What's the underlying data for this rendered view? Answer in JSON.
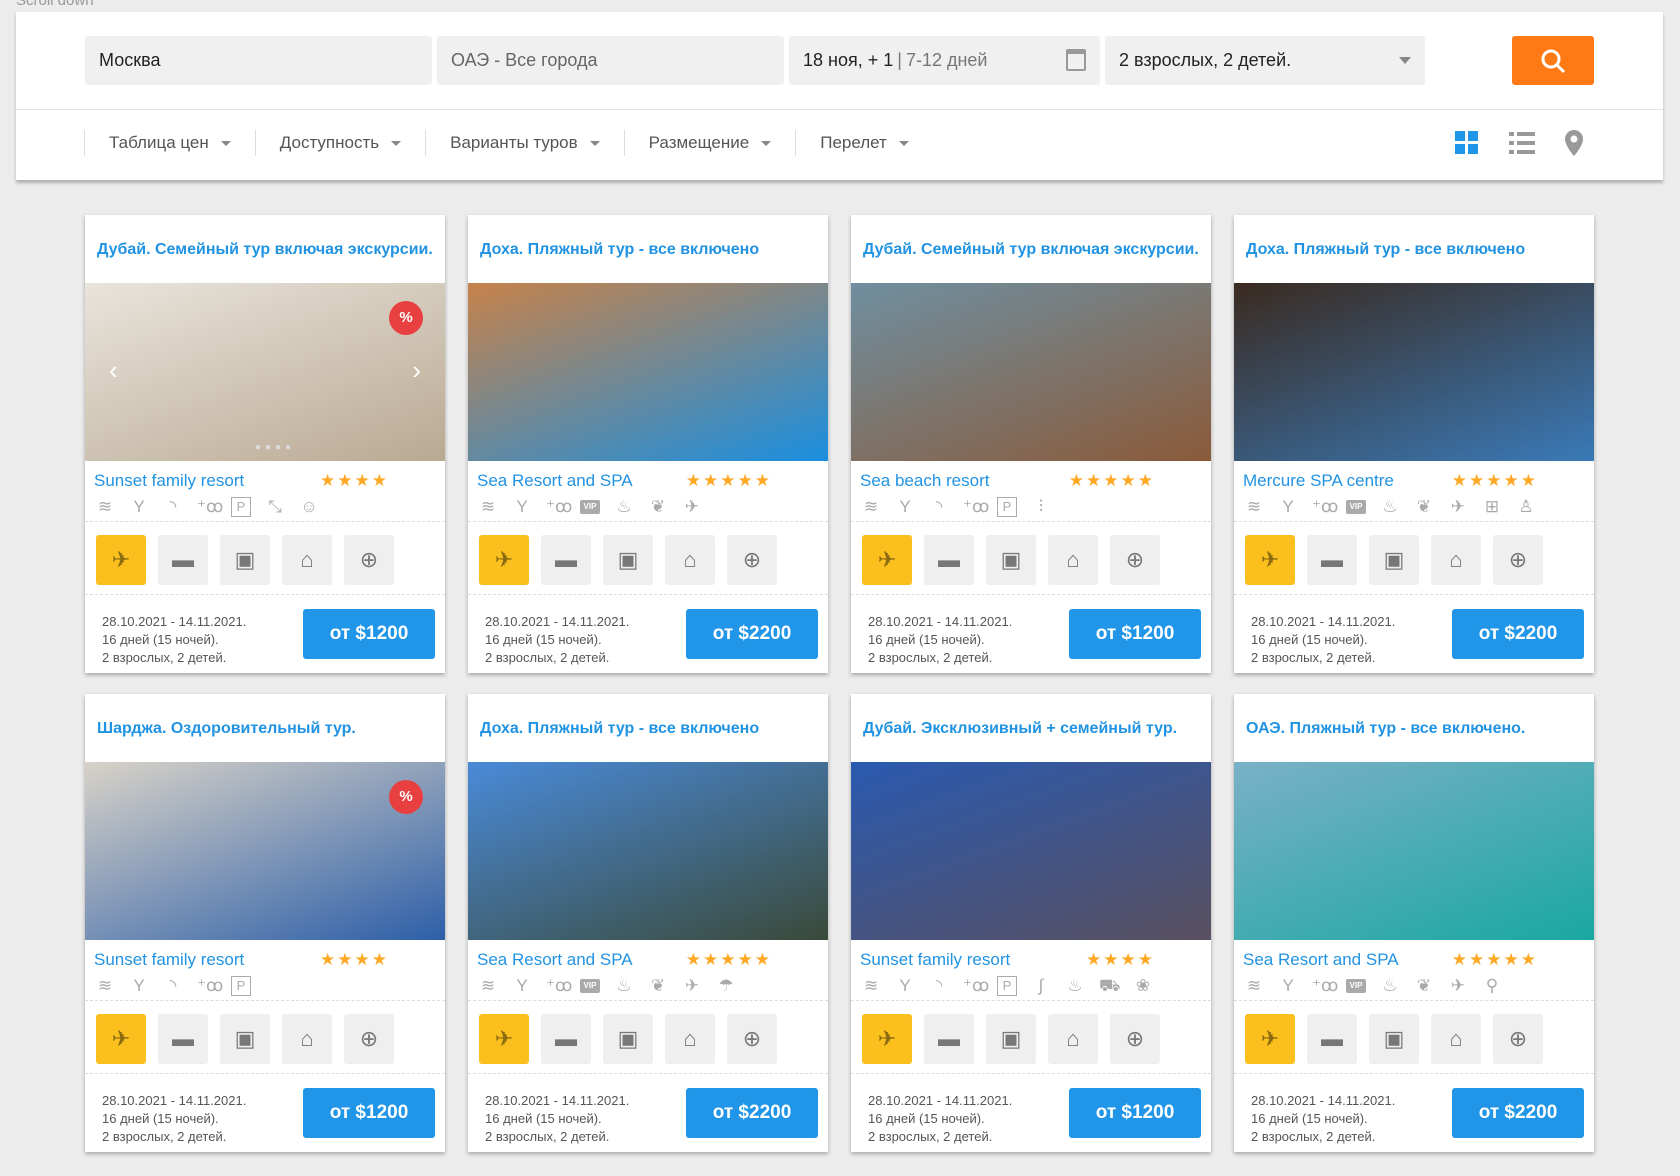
{
  "scroll_hint": "Scroll down",
  "search": {
    "from": "Москва",
    "to": "ОАЭ - Все города",
    "date_main": "18 ноя, + 1",
    "date_range": "7-12 дней",
    "guests": "2 взрослых, 2 детей."
  },
  "filters": [
    "Таблица цен",
    "Доступность",
    "Варианты туров",
    "Размещение",
    "Перелет"
  ],
  "colors": {
    "accent": "#2196e8",
    "search_button": "#ff7a14",
    "stars": "#ffa826",
    "active_service": "#fbbf1e"
  },
  "services": [
    "plane-icon",
    "bed-icon",
    "bus-icon",
    "museum-icon",
    "globe-icon"
  ],
  "cards": [
    {
      "title": "Дубай. Семейный тур включая экскурсии.",
      "hotel": "Sunset family resort",
      "stars": 4,
      "discount": true,
      "carousel": true,
      "amenities": [
        "pool",
        "bar",
        "wifi",
        "family",
        "parking",
        "gym",
        "baby"
      ],
      "dates": "28.10.2021 - 14.11.2021.",
      "duration": "16 дней (15 ночей).",
      "guests": "2 взрослых, 2 детей.",
      "price": "от $1200",
      "photo": [
        "#e9e4dc",
        "#b9a992"
      ]
    },
    {
      "title": "Доха. Пляжный тур - все включено",
      "hotel": "Sea Resort and SPA",
      "stars": 5,
      "discount": false,
      "carousel": false,
      "amenities": [
        "pool",
        "bar",
        "family",
        "vip",
        "spa",
        "eco",
        "airport"
      ],
      "dates": "28.10.2021 - 14.11.2021.",
      "duration": "16 дней (15 ночей).",
      "guests": "2 взрослых, 2 детей.",
      "price": "от $2200",
      "photo": [
        "#c7824a",
        "#1a8fe0"
      ]
    },
    {
      "title": "Дубай. Семейный тур включая экскурсии.",
      "hotel": "Sea beach resort",
      "stars": 5,
      "discount": false,
      "carousel": false,
      "amenities": [
        "pool",
        "bar",
        "wifi",
        "family",
        "parking",
        "pool-lift"
      ],
      "dates": "28.10.2021 - 14.11.2021.",
      "duration": "16 дней (15 ночей).",
      "guests": "2 взрослых, 2 детей.",
      "price": "от $1200",
      "photo": [
        "#6f8fa0",
        "#8a5a3a"
      ]
    },
    {
      "title": "Доха. Пляжный тур - все включено",
      "hotel": "Mercure SPA centre",
      "stars": 5,
      "discount": false,
      "carousel": false,
      "amenities": [
        "pool",
        "bar",
        "family",
        "vip",
        "spa",
        "eco",
        "airport",
        "medical",
        "kids"
      ],
      "dates": "28.10.2021 - 14.11.2021.",
      "duration": "16 дней (15 ночей).",
      "guests": "2 взрослых, 2 детей.",
      "price": "от $2200",
      "photo": [
        "#3a2a20",
        "#3a7ab8"
      ]
    },
    {
      "title": "Шарджа. Оздоровительный тур.",
      "hotel": "Sunset family resort",
      "stars": 4,
      "discount": true,
      "carousel": false,
      "amenities": [
        "pool",
        "bar",
        "wifi",
        "family",
        "parking"
      ],
      "dates": "28.10.2021 - 14.11.2021.",
      "duration": "16 дней (15 ночей).",
      "guests": "2 взрослых, 2 детей.",
      "price": "от $1200",
      "photo": [
        "#d8d2c8",
        "#2d5fa8"
      ]
    },
    {
      "title": "Доха. Пляжный тур - все включено",
      "hotel": "Sea Resort and SPA",
      "stars": 5,
      "discount": false,
      "carousel": false,
      "amenities": [
        "pool",
        "bar",
        "family",
        "vip",
        "spa",
        "eco",
        "airport",
        "beach"
      ],
      "dates": "28.10.2021 - 14.11.2021.",
      "duration": "16 дней (15 ночей).",
      "guests": "2 взрослых, 2 детей.",
      "price": "от $2200",
      "photo": [
        "#4a8ad8",
        "#3a4a3a"
      ]
    },
    {
      "title": "Дубай. Эксклюзивный + семейный тур.",
      "hotel": "Sunset family resort",
      "stars": 4,
      "discount": false,
      "carousel": false,
      "amenities": [
        "pool",
        "bar",
        "wifi",
        "family",
        "parking",
        "fitness",
        "spa",
        "stroller",
        "pets"
      ],
      "dates": "28.10.2021 - 14.11.2021.",
      "duration": "16 дней (15 ночей).",
      "guests": "2 взрослых, 2 детей.",
      "price": "от $1200",
      "photo": [
        "#2a5ab0",
        "#5a5060"
      ]
    },
    {
      "title": "ОАЭ. Пляжный тур - все включено.",
      "hotel": "Sea Resort and SPA",
      "stars": 5,
      "discount": false,
      "carousel": false,
      "amenities": [
        "pool",
        "bar",
        "family",
        "vip",
        "spa",
        "eco",
        "airport",
        "bicycle"
      ],
      "dates": "28.10.2021 - 14.11.2021.",
      "duration": "16 дней (15 ночей).",
      "guests": "2 взрослых, 2 детей.",
      "price": "от $2200",
      "photo": [
        "#7ab0c8",
        "#1aa8a0"
      ]
    }
  ]
}
